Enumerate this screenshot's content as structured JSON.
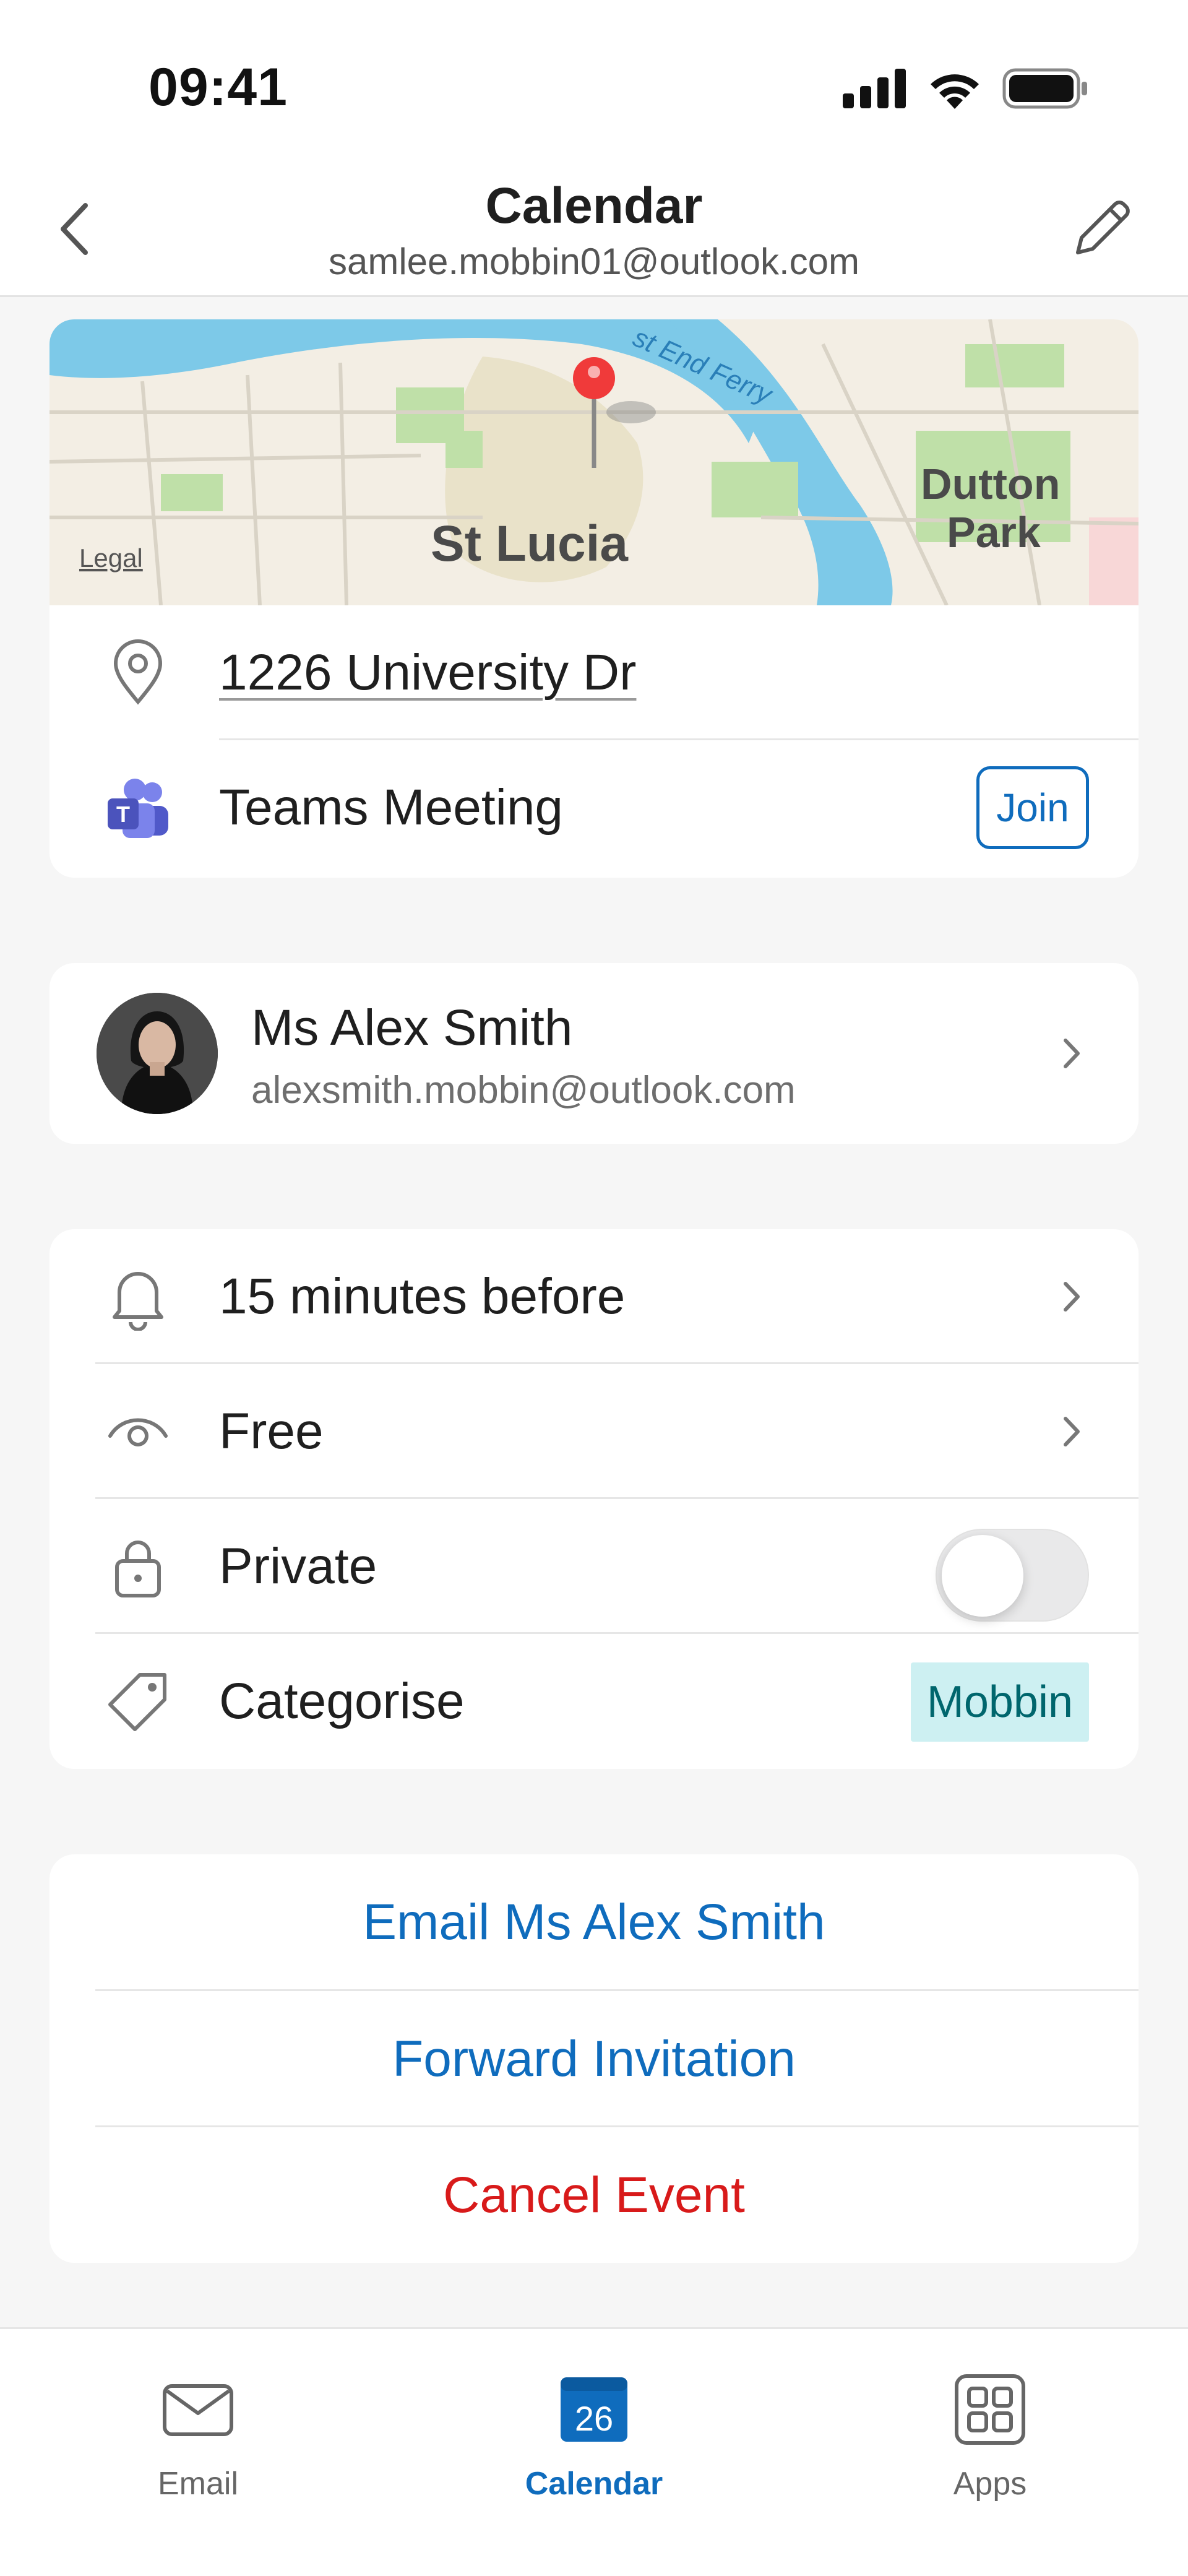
{
  "status_bar": {
    "time": "09:41"
  },
  "header": {
    "title": "Calendar",
    "subtitle": "samlee.mobbin01@outlook.com"
  },
  "map": {
    "labels": [
      "St Lucia",
      "Dutton",
      "Park",
      "st End Ferry"
    ],
    "legal": "Legal"
  },
  "location": {
    "address": "1226 University Dr",
    "meeting_label": "Teams Meeting",
    "join_label": "Join"
  },
  "organizer": {
    "name": "Ms Alex Smith",
    "email": "alexsmith.mobbin@outlook.com"
  },
  "settings": {
    "reminder": "15 minutes before",
    "show_as": "Free",
    "private_label": "Private",
    "private_on": false,
    "categorise_label": "Categorise",
    "category_tag": "Mobbin"
  },
  "actions": {
    "email": "Email Ms Alex Smith",
    "forward": "Forward Invitation",
    "cancel": "Cancel Event"
  },
  "tabs": [
    {
      "label": "Email",
      "icon": "mail-icon",
      "active": false
    },
    {
      "label": "Calendar",
      "icon": "calendar-icon",
      "badge": "26",
      "active": true
    },
    {
      "label": "Apps",
      "icon": "apps-grid-icon",
      "active": false
    }
  ],
  "colors": {
    "accent": "#0f6cbd",
    "danger": "#d81a1a",
    "tag_bg": "#cdf0f2",
    "tag_text": "#00666d",
    "pin": "#f03a3a"
  }
}
